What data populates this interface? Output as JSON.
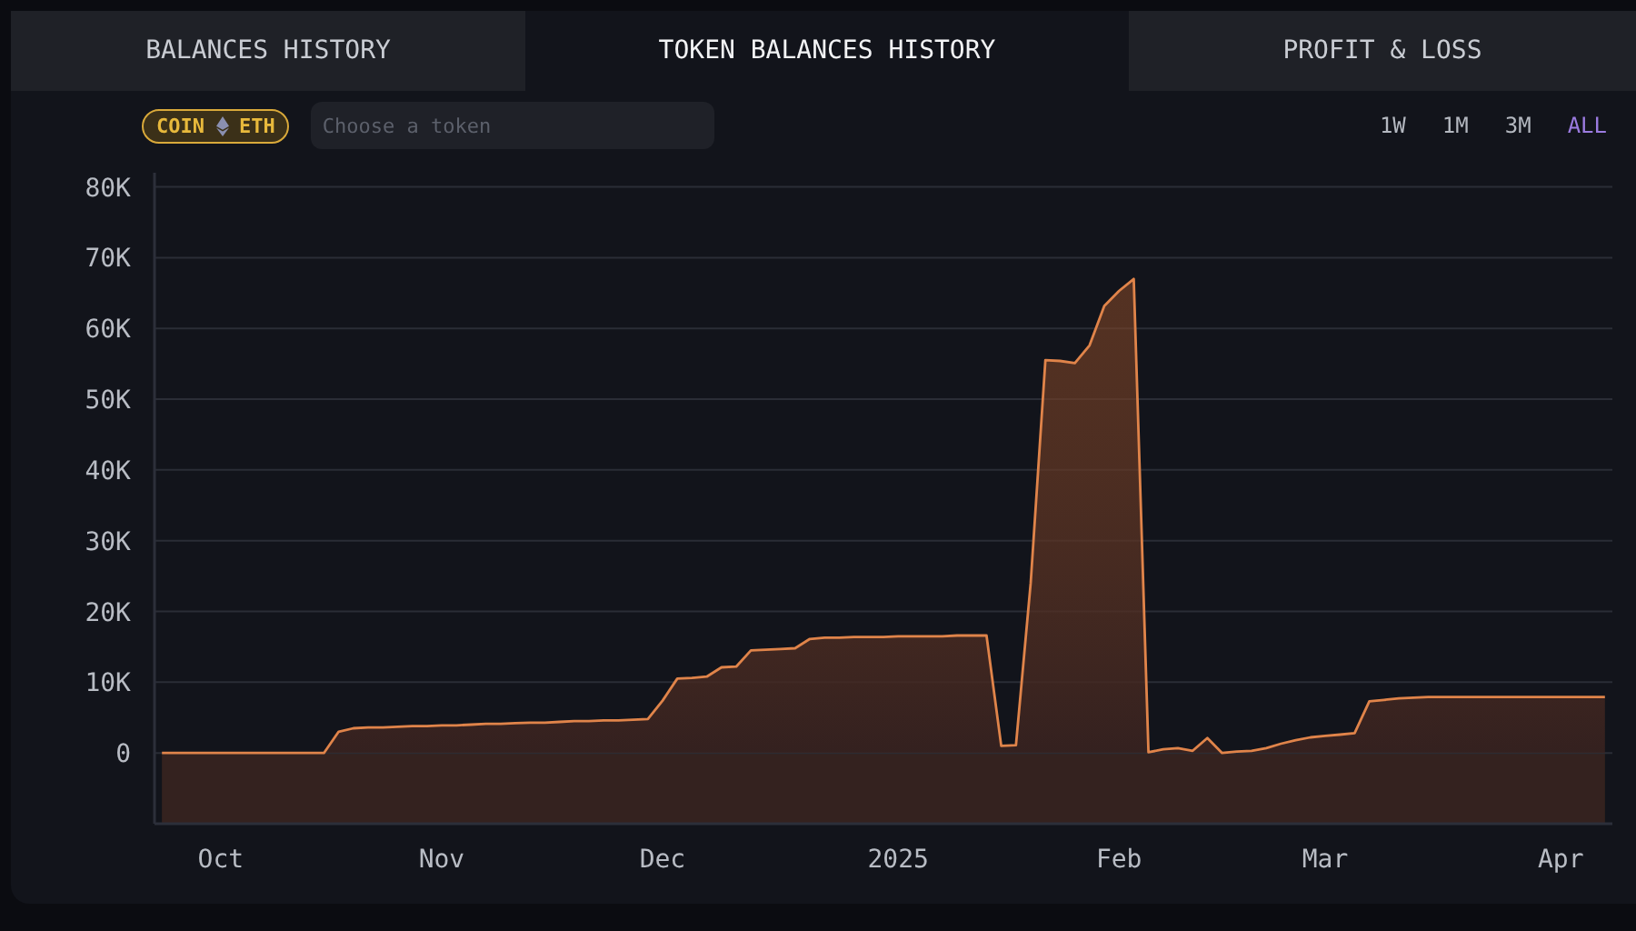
{
  "tabs": [
    {
      "label": "BALANCES HISTORY",
      "selected": false
    },
    {
      "label": "TOKEN BALANCES HISTORY",
      "selected": true
    },
    {
      "label": "PROFIT & LOSS",
      "selected": false
    }
  ],
  "token_toggle": {
    "left": "COIN",
    "right": "ETH"
  },
  "token_search": {
    "placeholder": "Choose a token"
  },
  "ranges": [
    {
      "label": "1W",
      "selected": false
    },
    {
      "label": "1M",
      "selected": false
    },
    {
      "label": "3M",
      "selected": false
    },
    {
      "label": "ALL",
      "selected": true
    }
  ],
  "chart": {
    "chart_data": {
      "type": "area",
      "categories": [
        null,
        null,
        null,
        null,
        "Oct",
        null,
        null,
        null,
        null,
        null,
        null,
        null,
        null,
        null,
        null,
        null,
        null,
        null,
        null,
        "Nov",
        null,
        null,
        null,
        null,
        null,
        null,
        null,
        null,
        null,
        null,
        null,
        null,
        null,
        null,
        "Dec",
        null,
        null,
        null,
        null,
        null,
        null,
        null,
        null,
        null,
        null,
        null,
        null,
        null,
        null,
        null,
        "2025",
        null,
        null,
        null,
        null,
        null,
        null,
        null,
        null,
        null,
        null,
        null,
        null,
        null,
        null,
        "Feb",
        null,
        null,
        null,
        null,
        null,
        null,
        null,
        null,
        null,
        null,
        null,
        null,
        null,
        "Mar",
        null,
        null,
        null,
        null,
        null,
        null,
        null,
        null,
        null,
        null,
        null,
        null,
        null,
        null,
        null,
        "Apr",
        null,
        null,
        null
      ],
      "grid": true,
      "series": [
        {
          "color": "#e0844a",
          "values": [
            0,
            0,
            0,
            0,
            0,
            0,
            0,
            0,
            0,
            0,
            0,
            0,
            3000,
            3500,
            3600,
            3600,
            3700,
            3800,
            3800,
            3900,
            3900,
            4000,
            4100,
            4100,
            4200,
            4300,
            4300,
            4400,
            4500,
            4500,
            4600,
            4600,
            4700,
            4800,
            7400,
            10500,
            10600,
            10800,
            12100,
            12200,
            14500,
            14600,
            14700,
            14800,
            16100,
            16300,
            16300,
            16400,
            16400,
            16400,
            16500,
            16500,
            16500,
            16500,
            16600,
            16600,
            16600,
            1000,
            1100,
            24000,
            55500,
            55400,
            55100,
            57600,
            63200,
            65300,
            67000,
            100,
            500,
            700,
            300,
            2100,
            0,
            200,
            300,
            700,
            1300,
            1800,
            2200,
            2400,
            2600,
            2800,
            7300,
            7500,
            7700,
            7800,
            7900,
            7900,
            7900,
            7900,
            7900,
            7900,
            7900,
            7900,
            7900,
            7900,
            7900,
            7900,
            7900
          ]
        }
      ],
      "ylim": [
        -10000,
        82000
      ],
      "yticks": [
        {
          "value": 0,
          "label": "0"
        },
        {
          "value": 10000,
          "label": "10K"
        },
        {
          "value": 20000,
          "label": "20K"
        },
        {
          "value": 30000,
          "label": "30K"
        },
        {
          "value": 40000,
          "label": "40K"
        },
        {
          "value": 50000,
          "label": "50K"
        },
        {
          "value": 60000,
          "label": "60K"
        },
        {
          "value": 70000,
          "label": "70K"
        },
        {
          "value": 80000,
          "label": "80K"
        }
      ]
    }
  }
}
